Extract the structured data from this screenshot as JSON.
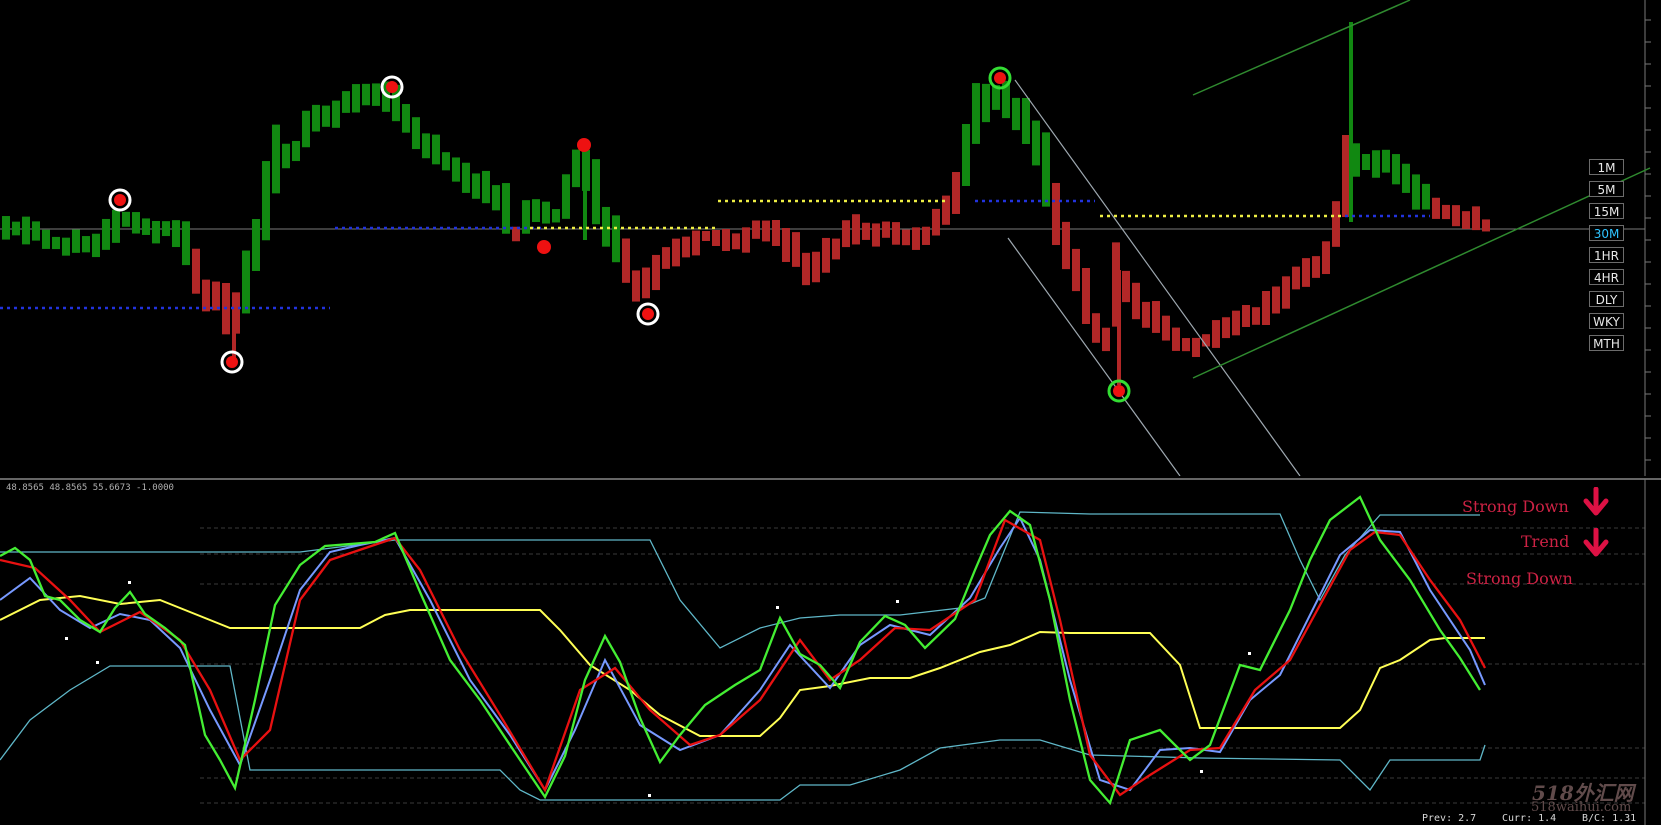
{
  "colors": {
    "bull": "#118811",
    "bear": "#b22727",
    "bg": "#000000",
    "ma_green": "#44ee33",
    "ma_blue": "#7799ff",
    "ma_red": "#e81111",
    "ma_yellow": "#ffff55",
    "band": "#5fb7c8",
    "label": "#cc2244"
  },
  "timeframes": [
    {
      "label": "1M",
      "active": false
    },
    {
      "label": "5M",
      "active": false
    },
    {
      "label": "15M",
      "active": false
    },
    {
      "label": "30M",
      "active": true
    },
    {
      "label": "1HR",
      "active": false
    },
    {
      "label": "4HR",
      "active": false
    },
    {
      "label": "DLY",
      "active": false
    },
    {
      "label": "WKY",
      "active": false
    },
    {
      "label": "MTH",
      "active": false
    }
  ],
  "indicator_values": "48.8565 48.8565 55.6673 -1.0000",
  "signals": {
    "line1": "Strong Down",
    "line2": "Trend",
    "line3": "Strong Down",
    "arrow_icon": "down-arrow-icon"
  },
  "footer": {
    "prev": "Prev: 2.7",
    "curr": "Curr: 1.4",
    "bo": "B/C: 1.31"
  },
  "watermark": {
    "main": "518外汇网",
    "sub": "518waihui.com"
  }
}
